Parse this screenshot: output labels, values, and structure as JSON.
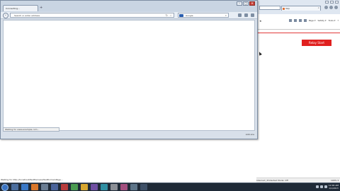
{
  "background_window": {
    "tab_title": "Yelp",
    "menu": {
      "page": "Page ▾",
      "safety": "Safety ▾",
      "tools": "Tools ▾",
      "help": "?"
    },
    "cta_button": "Relay Start",
    "status_zone": "Internet | Protected Mode: Off",
    "status_zoom": "100% ▾"
  },
  "background_status_left": "Waiting for http://localhost/TestHarness/TestDomainPage...",
  "browser": {
    "tab_title": "Connecting...",
    "url_placeholder": "Search or enter address",
    "search_engine": "Google",
    "loading_text": "Waiting for www.example.com...",
    "status_addon": "Add-ons"
  },
  "caption_buttons": {
    "min": "–",
    "max": "□",
    "close": "✕"
  },
  "taskbar": {
    "time": "12:00 AM",
    "date": "1/1/2013"
  }
}
